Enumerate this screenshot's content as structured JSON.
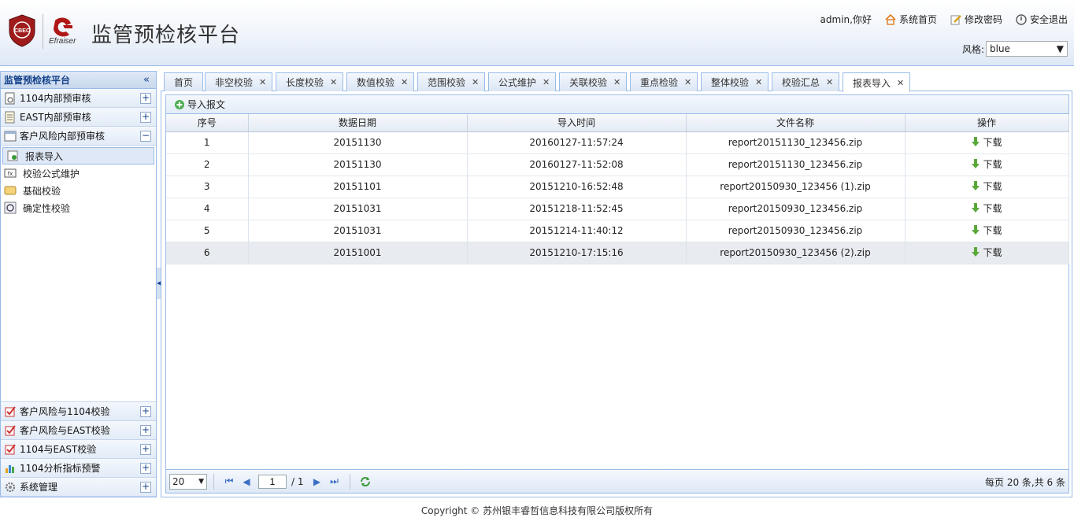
{
  "app": {
    "title": "监管预检核平台",
    "logo_text": "Efraiser",
    "shield_text": "CBEC"
  },
  "header": {
    "greeting": "admin,你好",
    "home_label": "系统首页",
    "password_label": "修改密码",
    "logout_label": "安全退出",
    "style_label": "风格:",
    "style_value": "blue"
  },
  "sidebar": {
    "title": "监管预检核平台",
    "groups": [
      {
        "label": "1104内部预审核",
        "toggle": "+"
      },
      {
        "label": "EAST内部预审核",
        "toggle": "+"
      },
      {
        "label": "客户风险内部预审核",
        "toggle": "−"
      }
    ],
    "sub_items": [
      {
        "label": "报表导入"
      },
      {
        "label": "校验公式维护"
      },
      {
        "label": "基础校验"
      },
      {
        "label": "确定性校验"
      }
    ],
    "bottom_groups": [
      {
        "label": "客户风险与1104校验",
        "toggle": "+"
      },
      {
        "label": "客户风险与EAST校验",
        "toggle": "+"
      },
      {
        "label": "1104与EAST校验",
        "toggle": "+"
      },
      {
        "label": "1104分析指标预警",
        "toggle": "+"
      },
      {
        "label": "系统管理",
        "toggle": "+"
      }
    ]
  },
  "tabs": [
    {
      "label": "首页",
      "closable": false
    },
    {
      "label": "非空校验",
      "closable": true
    },
    {
      "label": "长度校验",
      "closable": true
    },
    {
      "label": "数值校验",
      "closable": true
    },
    {
      "label": "范围校验",
      "closable": true
    },
    {
      "label": "公式维护",
      "closable": true
    },
    {
      "label": "关联校验",
      "closable": true
    },
    {
      "label": "重点检验",
      "closable": true
    },
    {
      "label": "整体校验",
      "closable": true
    },
    {
      "label": "校验汇总",
      "closable": true
    },
    {
      "label": "报表导入",
      "closable": true,
      "active": true
    }
  ],
  "toolbar": {
    "import_label": "导入报文"
  },
  "grid": {
    "columns": [
      "序号",
      "数据日期",
      "导入时间",
      "文件名称",
      "操作"
    ],
    "rows": [
      [
        "1",
        "20151130",
        "20160127-11:57:24",
        "report20151130_123456.zip",
        "下载"
      ],
      [
        "2",
        "20151130",
        "20160127-11:52:08",
        "report20151130_123456.zip",
        "下载"
      ],
      [
        "3",
        "20151101",
        "20151210-16:52:48",
        "report20150930_123456 (1).zip",
        "下载"
      ],
      [
        "4",
        "20151031",
        "20151218-11:52:45",
        "report20150930_123456.zip",
        "下载"
      ],
      [
        "5",
        "20151031",
        "20151214-11:40:12",
        "report20150930_123456.zip",
        "下载"
      ],
      [
        "6",
        "20151001",
        "20151210-17:15:16",
        "report20150930_123456 (2).zip",
        "下载"
      ]
    ]
  },
  "pager": {
    "page_size": "20",
    "current_page": "1",
    "total_pages": "/ 1",
    "info": "每页 20 条,共 6 条"
  },
  "footer": {
    "copyright": "Copyright © 苏州银丰睿哲信息科技有限公司版权所有"
  }
}
